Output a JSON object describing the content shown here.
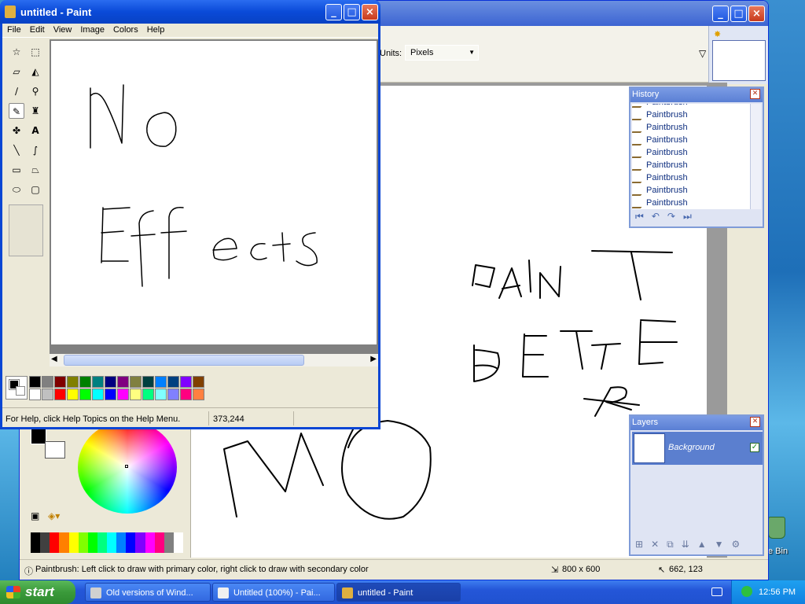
{
  "desktop": {
    "recycle_bin_label": "e Bin"
  },
  "paintdotnet": {
    "window_controls": [
      "_",
      "□",
      "×"
    ],
    "units_label": "Units:",
    "units_value": "Pixels",
    "status_help": "Paintbrush: Left click to draw with primary color, right click to draw with secondary color",
    "image_size": "800 x 600",
    "cursor_pos": "662, 123",
    "palette_colors": [
      "#000000",
      "#404040",
      "#ff0000",
      "#ff8000",
      "#ffff00",
      "#80ff00",
      "#00ff00",
      "#00ff80",
      "#00ffff",
      "#0080ff",
      "#0000ff",
      "#8000ff",
      "#ff00ff",
      "#ff0080",
      "#808080",
      "#ffffff"
    ]
  },
  "history": {
    "title": "History",
    "items": [
      "Paintbrush",
      "Paintbrush",
      "Paintbrush",
      "Paintbrush",
      "Paintbrush",
      "Paintbrush",
      "Paintbrush",
      "Paintbrush",
      "Paintbrush"
    ]
  },
  "layers": {
    "title": "Layers",
    "items": [
      {
        "name": "Background",
        "visible": true
      }
    ]
  },
  "mspaint": {
    "title": "untitled - Paint",
    "window_controls": [
      "_",
      "□",
      "×"
    ],
    "menu": [
      "File",
      "Edit",
      "View",
      "Image",
      "Colors",
      "Help"
    ],
    "status_help": "For Help, click Help Topics on the Help Menu.",
    "status_coords": "373,244",
    "palette": [
      "#000000",
      "#808080",
      "#800000",
      "#808000",
      "#008000",
      "#008080",
      "#000080",
      "#800080",
      "#808040",
      "#004040",
      "#0080ff",
      "#004080",
      "#8000ff",
      "#804000",
      "#ffffff",
      "#c0c0c0",
      "#ff0000",
      "#ffff00",
      "#00ff00",
      "#00ffff",
      "#0000ff",
      "#ff00ff",
      "#ffff80",
      "#00ff80",
      "#80ffff",
      "#8080ff",
      "#ff0080",
      "#ff8040"
    ]
  },
  "taskbar": {
    "start_label": "start",
    "tasks": [
      {
        "label": "Old versions of Wind...",
        "active": false
      },
      {
        "label": "Untitled (100%) - Pai...",
        "active": false
      },
      {
        "label": "untitled - Paint",
        "active": true
      }
    ],
    "clock": "12:56 PM"
  }
}
